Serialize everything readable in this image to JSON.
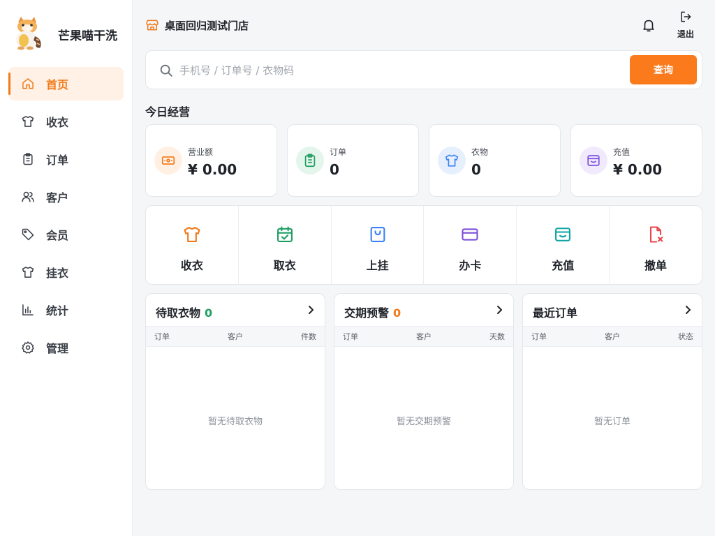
{
  "brand": {
    "name": "芒果喵干洗"
  },
  "sidebar": {
    "items": [
      {
        "label": "首页",
        "icon": "home-icon",
        "active": true
      },
      {
        "label": "收衣",
        "icon": "shirt-icon"
      },
      {
        "label": "订单",
        "icon": "clipboard-icon"
      },
      {
        "label": "客户",
        "icon": "users-icon"
      },
      {
        "label": "会员",
        "icon": "tag-icon"
      },
      {
        "label": "挂衣",
        "icon": "shirt-icon"
      },
      {
        "label": "统计",
        "icon": "bar-chart-icon"
      },
      {
        "label": "管理",
        "icon": "gear-icon"
      }
    ]
  },
  "header": {
    "store_name": "桌面回归测试门店",
    "logout_label": "退出"
  },
  "search": {
    "placeholder": "手机号 / 订单号 / 衣物码",
    "value": "",
    "button_label": "查询"
  },
  "today": {
    "title": "今日经营",
    "stats": [
      {
        "label": "营业额",
        "value": "¥ 0.00",
        "icon": "cash-icon"
      },
      {
        "label": "订单",
        "value": "0",
        "icon": "clipboard-icon"
      },
      {
        "label": "衣物",
        "value": "0",
        "icon": "shirt-icon"
      },
      {
        "label": "充值",
        "value": "¥ 0.00",
        "icon": "wallet-icon"
      }
    ]
  },
  "actions": [
    {
      "label": "收衣",
      "icon": "shirt-icon"
    },
    {
      "label": "取衣",
      "icon": "calendar-check-icon"
    },
    {
      "label": "上挂",
      "icon": "bag-icon"
    },
    {
      "label": "办卡",
      "icon": "card-icon"
    },
    {
      "label": "充值",
      "icon": "wallet-icon"
    },
    {
      "label": "撤单",
      "icon": "file-cancel-icon"
    }
  ],
  "panels": [
    {
      "title": "待取衣物",
      "count": "0",
      "columns": [
        "订单",
        "客户",
        "件数"
      ],
      "empty": "暂无待取衣物"
    },
    {
      "title": "交期预警",
      "count": "0",
      "columns": [
        "订单",
        "客户",
        "天数"
      ],
      "empty": "暂无交期预警"
    },
    {
      "title": "最近订单",
      "count": "",
      "columns": [
        "订单",
        "客户",
        "状态"
      ],
      "empty": "暂无订单"
    }
  ],
  "colors": {
    "accent": "#fb7a1c",
    "active_nav_bg": "#fff1e6",
    "green_count": "#1f9d63",
    "orange_count": "#f07a1a"
  }
}
